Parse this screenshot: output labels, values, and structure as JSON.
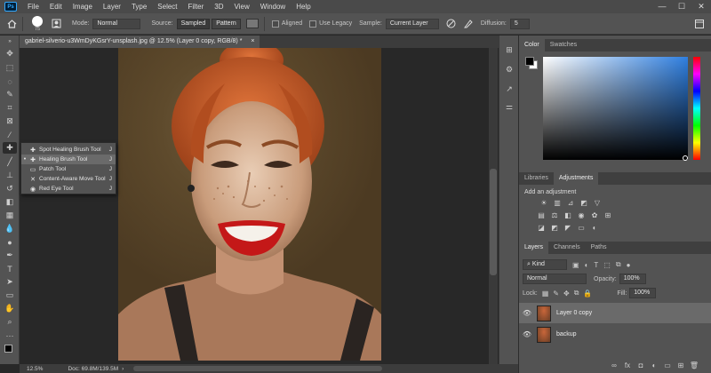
{
  "menubar": {
    "logo": "Ps",
    "items": [
      "File",
      "Edit",
      "Image",
      "Layer",
      "Type",
      "Select",
      "Filter",
      "3D",
      "View",
      "Window",
      "Help"
    ],
    "window_controls": [
      "—",
      "☐",
      "✕"
    ]
  },
  "options": {
    "brush_size": "75",
    "mode_label": "Mode:",
    "mode_value": "Normal",
    "source_label": "Source:",
    "source_sampled": "Sampled",
    "source_pattern": "Pattern",
    "aligned_label": "Aligned",
    "legacy_label": "Use Legacy",
    "sample_label": "Sample:",
    "sample_value": "Current Layer",
    "diffusion_label": "Diffusion:",
    "diffusion_value": "5"
  },
  "document": {
    "tab_title": "gabriel-silverio-u3WmDyKGsrY-unsplash.jpg @ 12.5% (Layer 0 copy, RGB/8) *",
    "tab_close": "×"
  },
  "flyout": {
    "items": [
      {
        "label": "Spot Healing Brush Tool",
        "key": "J",
        "selected": false
      },
      {
        "label": "Healing Brush Tool",
        "key": "J",
        "selected": true
      },
      {
        "label": "Patch Tool",
        "key": "J",
        "selected": false
      },
      {
        "label": "Content-Aware Move Tool",
        "key": "J",
        "selected": false
      },
      {
        "label": "Red Eye Tool",
        "key": "J",
        "selected": false
      }
    ]
  },
  "status": {
    "zoom": "12.5%",
    "doc": "Doc: 69.8M/139.5M"
  },
  "color_panel": {
    "tabs": [
      "Color",
      "Swatches"
    ],
    "foreground": "#000000",
    "background": "#ffffff"
  },
  "adjust_panel": {
    "tabs": [
      "Libraries",
      "Adjustments"
    ],
    "add_label": "Add an adjustment"
  },
  "layers_panel": {
    "tabs": [
      "Layers",
      "Channels",
      "Paths"
    ],
    "filter_value": "Kind",
    "blend_value": "Normal",
    "opacity_label": "Opacity:",
    "opacity_value": "100%",
    "lock_label": "Lock:",
    "fill_label": "Fill:",
    "fill_value": "100%",
    "layers": [
      {
        "name": "Layer 0 copy",
        "active": true
      },
      {
        "name": "backup",
        "active": false
      }
    ]
  }
}
